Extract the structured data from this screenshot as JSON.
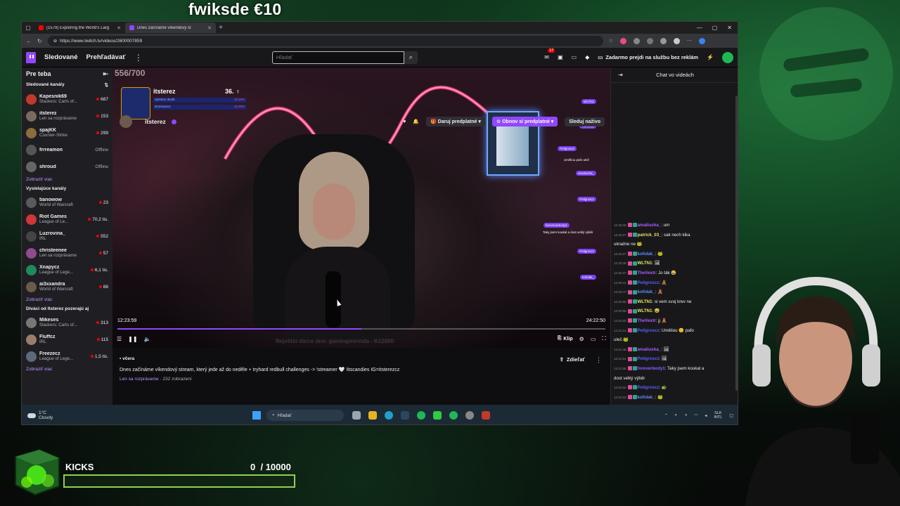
{
  "overlay": {
    "goal_text": "fwiksde €10",
    "kicks_label": "KICKS",
    "kicks_current": "0",
    "kicks_total": "/ 10000",
    "kicks_progress": 0
  },
  "browser": {
    "tabs": [
      {
        "label": "(1579) Exploring the World's Larg",
        "active": false,
        "color": "#ff0000"
      },
      {
        "label": "Dnes začínáme víkendový st",
        "active": true,
        "color": "#9147ff"
      }
    ],
    "url": "https://www.twitch.tv/videos/2600007859"
  },
  "twitch": {
    "nav": {
      "following": "Sledované",
      "browse": "Prehľadávať",
      "search_placeholder": "Hľadať",
      "notif_count": "17",
      "turbo": "Zadarmo prejdi na službu bez reklám"
    },
    "sidebar": {
      "title": "Pre teba",
      "followed_title": "Sledované kanály",
      "followed": [
        {
          "name": "Kapesnik69",
          "game": "Slackers: Carts of...",
          "viewers": "687",
          "online": true,
          "color": "#c0392b"
        },
        {
          "name": "itsterez",
          "game": "Len sa rozprávame",
          "viewers": "153",
          "online": true,
          "color": "#7b6b5e"
        },
        {
          "name": "spajKK",
          "game": "Counter-Strike",
          "viewers": "299",
          "online": true,
          "color": "#8a6d3b"
        },
        {
          "name": "frrreamon",
          "game": "",
          "viewers": "Offline",
          "online": false,
          "color": "#555"
        },
        {
          "name": "shroud",
          "game": "",
          "viewers": "Offline",
          "online": false,
          "color": "#666"
        }
      ],
      "show_more": "Zobraziť viac",
      "live_title": "Vysielajúce kanály",
      "live": [
        {
          "name": "tianowow",
          "game": "World of Warcraft",
          "viewers": "23",
          "color": "#5a5a5a"
        },
        {
          "name": "Riot Games",
          "game": "League of Le...",
          "viewers": "70,2 tis.",
          "color": "#d13639"
        },
        {
          "name": "Luzrovina_",
          "game": "IRL",
          "viewers": "552",
          "color": "#444"
        },
        {
          "name": "christeenee",
          "game": "Len sa rozprávame",
          "viewers": "57",
          "color": "#8e4b8e"
        },
        {
          "name": "Xnapycz",
          "game": "League of Lege...",
          "viewers": "6,1 tis.",
          "color": "#1f8a5b"
        },
        {
          "name": "ai3xxandra",
          "game": "World of Warcraft",
          "viewers": "88",
          "color": "#6c5a4c"
        }
      ],
      "similar_title": "Diváci od Itsterez pozerajú aj",
      "similar": [
        {
          "name": "Mikeses",
          "game": "Slackers: Carts of...",
          "viewers": "313",
          "color": "#777"
        },
        {
          "name": "Fluffcz",
          "game": "IRL",
          "viewers": "115",
          "color": "#9a7d6b"
        },
        {
          "name": "Freezecz",
          "game": "League of Lege...",
          "viewers": "1,5 tis.",
          "color": "#5b6b7b"
        }
      ]
    },
    "player": {
      "vod_counter": "556/700",
      "streamer_overlay_name": "itsterez",
      "streamer_overlay_rank": "36.",
      "overlay_rows": [
        {
          "label": "Splněno úkolů",
          "value": "19,18%"
        },
        {
          "label": "Dominance",
          "value": "10,26%"
        }
      ],
      "chat_overlay": [
        "WLTN1",
        "TheVextr",
        "Peligroscz",
        "Uměliou pafo uteč",
        "amaliusha_",
        "Peligroscz",
        "foreveraebody1",
        "Taky jsem koukal a dost velký výběr",
        "Peligroscz",
        "kofolak_"
      ],
      "current_time": "12:23:59",
      "total_time": "24:22:50",
      "progress": 0.5,
      "donate_overlay": "Největší dárce dne: gamingmirinda - Kč2000",
      "clip_label": "Klip"
    },
    "info": {
      "date": "včera",
      "title": "Dnes začínáme víkendový stream, který jede až do neděle + tryhard redbull challenges -> !streamer 🤍 !itscandies IG=itsterezcz",
      "category": "Len sa rozprávame",
      "views": "· 232 zobrazení",
      "share": "Zdieľať",
      "channel_name": "itsterez",
      "gift": "Daruj predplatné",
      "renew": "Obnov si predplatné",
      "watch_live": "Sleduj naživo"
    },
    "chat": {
      "title": "Chat vo videách",
      "messages": [
        {
          "ts": "12:20:26",
          "user": "amaliusha_",
          "color": "#b05cff",
          "text": ": um"
        },
        {
          "ts": "12:20:27",
          "user": "patrick_03_",
          "color": "#e6e65c",
          "text": ": sak nech kika"
        },
        {
          "ts": "",
          "user": "",
          "color": "#efeff1",
          "text": "ukradne ne 🐸"
        },
        {
          "ts": "12:20:27",
          "user": "kofolak_",
          "color": "#5c8cff",
          "text": ": 🐸"
        },
        {
          "ts": "12:20:28",
          "user": "WLTN1",
          "color": "#e6e65c",
          "text": ": 🖼"
        },
        {
          "ts": "12:20:37",
          "user": "TheVextr",
          "color": "#b05cff",
          "text": ": Jo ták 😂"
        },
        {
          "ts": "12:20:41",
          "user": "Peligroscz",
          "color": "#5c5cff",
          "text": ": 🧸"
        },
        {
          "ts": "12:20:47",
          "user": "kofolak_",
          "color": "#5c8cff",
          "text": ": 🧸"
        },
        {
          "ts": "12:20:55",
          "user": "WLTN1",
          "color": "#e6e65c",
          "text": ": si vem svoj krev ne"
        },
        {
          "ts": "12:20:55",
          "user": "WLTN1",
          "color": "#e6e65c",
          "text": ": 😅"
        },
        {
          "ts": "12:21:03",
          "user": "TheVextr",
          "color": "#b05cff",
          "text": ": jj 🧸"
        },
        {
          "ts": "12:21:14",
          "user": "Peligroscz",
          "color": "#5c5cff",
          "text": ": Uměliou 😊 pafo"
        },
        {
          "ts": "",
          "user": "",
          "color": "#efeff1",
          "text": "uteč 🐸"
        },
        {
          "ts": "12:21:46",
          "user": "amaliusha_",
          "color": "#b05cff",
          "text": ": 🖼"
        },
        {
          "ts": "12:21:54",
          "user": "Peligroscz",
          "color": "#5c5cff",
          "text": ": 🖼"
        },
        {
          "ts": "12:21:58",
          "user": "foreverbody1",
          "color": "#8a5cff",
          "text": ": Taky jsem koukal a"
        },
        {
          "ts": "",
          "user": "",
          "color": "#efeff1",
          "text": "dost velký výběr"
        },
        {
          "ts": "12:22:02",
          "user": "Peligroscz",
          "color": "#5c5cff",
          "text": ": 🐢"
        },
        {
          "ts": "12:22:03",
          "user": "kofolak_",
          "color": "#5c8cff",
          "text": ": 🐸"
        }
      ]
    }
  },
  "taskbar": {
    "weather_temp": "1°C",
    "weather_desc": "Cloudy",
    "search": "Hľadať",
    "lang_top": "SLK",
    "lang_bottom": "INTL"
  }
}
